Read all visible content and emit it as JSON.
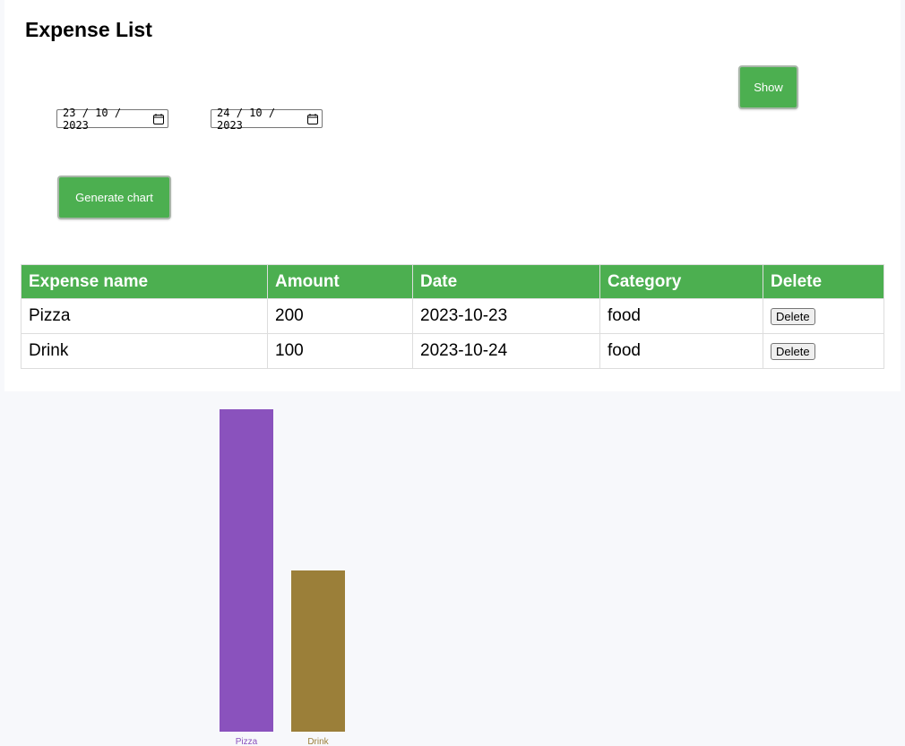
{
  "page": {
    "title": "Expense List"
  },
  "filters": {
    "start_date": {
      "day": "23",
      "month": "10",
      "year": "2023"
    },
    "end_date": {
      "day": "24",
      "month": "10",
      "year": "2023"
    },
    "date_sep": "/",
    "show_label": "Show",
    "generate_chart_label": "Generate chart",
    "calendar_icon": "calendar-icon"
  },
  "table": {
    "headers": [
      "Expense name",
      "Amount",
      "Date",
      "Category",
      "Delete"
    ],
    "rows": [
      {
        "name": "Pizza",
        "amount": "200",
        "date": "2023-10-23",
        "category": "food",
        "delete_label": "Delete"
      },
      {
        "name": "Drink",
        "amount": "100",
        "date": "2023-10-24",
        "category": "food",
        "delete_label": "Delete"
      }
    ]
  },
  "colors": {
    "accent": "#4caf50",
    "page_bg": "#f7f8fb"
  },
  "chart_data": {
    "type": "bar",
    "categories": [
      "Pizza",
      "Drink"
    ],
    "values": [
      200,
      100
    ],
    "colors": [
      "#8a52bd",
      "#9b7f39"
    ],
    "title": "",
    "xlabel": "",
    "ylabel": "",
    "ylim": [
      0,
      200
    ],
    "grid": false,
    "legend": "none"
  }
}
